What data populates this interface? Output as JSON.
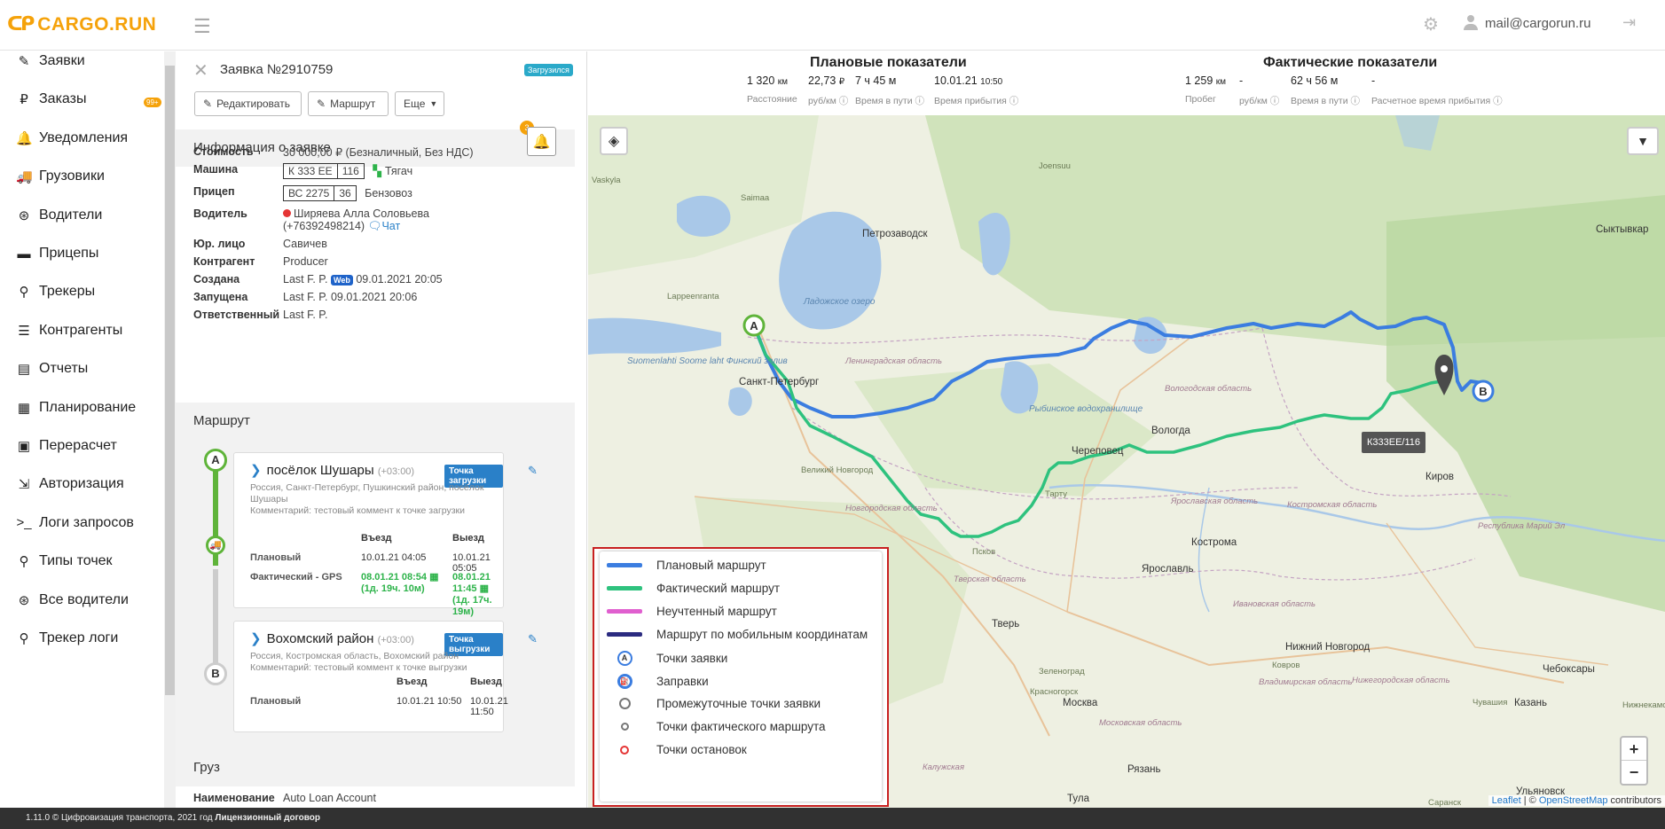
{
  "brand": {
    "name": "CARGO.RUN",
    "accent": "#f5a20a"
  },
  "topbar": {
    "user_email": "mail@cargorun.ru"
  },
  "sidebar": {
    "items": [
      {
        "label": "Заявки",
        "icon": "edit-icon"
      },
      {
        "label": "Заказы",
        "icon": "ruble-icon"
      },
      {
        "label": "Уведомления",
        "icon": "bell-icon",
        "badge": "99+"
      },
      {
        "label": "Грузовики",
        "icon": "truck-icon"
      },
      {
        "label": "Водители",
        "icon": "steering-wheel-icon"
      },
      {
        "label": "Прицепы",
        "icon": "trailer-icon"
      },
      {
        "label": "Трекеры",
        "icon": "map-pin-icon"
      },
      {
        "label": "Контрагенты",
        "icon": "list-icon"
      },
      {
        "label": "Отчеты",
        "icon": "clipboard-icon"
      },
      {
        "label": "Планирование",
        "icon": "calendar-icon"
      },
      {
        "label": "Перерасчет",
        "icon": "calculator-icon"
      },
      {
        "label": "Авторизация",
        "icon": "login-icon"
      },
      {
        "label": "Логи запросов",
        "icon": "terminal-icon"
      },
      {
        "label": "Типы точек",
        "icon": "map-pin-icon"
      },
      {
        "label": "Все водители",
        "icon": "steering-wheel-icon"
      },
      {
        "label": "Трекер логи",
        "icon": "map-pin-icon"
      }
    ]
  },
  "order": {
    "title": "Заявка №2910759",
    "status": "Загрузился",
    "buttons": {
      "edit": "Редактировать",
      "route": "Маршрут",
      "more": "Еще"
    },
    "info_heading": "Информация о заявке",
    "notifications_count": "3",
    "info": {
      "cost_label": "Стоимость",
      "cost": "30 000,00 ₽ (Безналичный, Без НДС)",
      "truck_label": "Машина",
      "truck_plate": "К 333 ЕЕ",
      "truck_region": "116",
      "truck_type": "Тягач",
      "trailer_label": "Прицеп",
      "trailer_plate": "ВС 2275",
      "trailer_region": "36",
      "trailer_type": "Бензовоз",
      "driver_label": "Водитель",
      "driver_name": "Ширяева Алла Соловьева",
      "driver_phone": "(+76392498214)",
      "chat": "Чат",
      "legal_label": "Юр. лицо",
      "legal": "Савичев",
      "contractor_label": "Контрагент",
      "contractor": "Producer",
      "created_label": "Создана",
      "created_by": "Last F. P.",
      "created_src": "Web",
      "created_at": "09.01.2021 20:05",
      "started_label": "Запущена",
      "started": "Last F. P. 09.01.2021 20:06",
      "responsible_label": "Ответственный",
      "responsible": "Last F. P."
    },
    "route_heading": "Маршрут",
    "stops": [
      {
        "letter": "A",
        "name": "посёлок Шушары",
        "tz": "(+03:00)",
        "tag": "Точка загрузки",
        "address": "Россия, Санкт-Петербург, Пушкинский район, посёлок Шушары",
        "comment": "Комментарий: тестовый коммент к точке загрузки",
        "col_in": "Въезд",
        "col_out": "Выезд",
        "plan_label": "Плановый",
        "plan_in": "10.01.21 04:05",
        "plan_out": "10.01.21 05:05",
        "fact_label": "Фактический - GPS",
        "fact_in": "08.01.21 08:54",
        "fact_in_dur": "(1д. 19ч. 10м)",
        "fact_out": "08.01.21 11:45",
        "fact_out_dur": "(1д. 17ч. 19м)"
      },
      {
        "letter": "B",
        "name": "Вохомский район",
        "tz": "(+03:00)",
        "tag": "Точка выгрузки",
        "address": "Россия, Костромская область, Вохомский район",
        "comment": "Комментарий: тестовый коммент к точке выгрузки",
        "col_in": "Въезд",
        "col_out": "Выезд",
        "plan_label": "Плановый",
        "plan_in": "10.01.21 10:50",
        "plan_out": "10.01.21 11:50"
      }
    ],
    "cargo_heading": "Груз",
    "cargo_name_label": "Наименование",
    "cargo_name": "Auto Loan Account"
  },
  "kpi": {
    "plan_title": "Плановые показатели",
    "plan": [
      {
        "value": "1 320",
        "unit": "км",
        "label": "Расстояние"
      },
      {
        "value": "22,73",
        "unit": "₽",
        "label": "руб/км"
      },
      {
        "value": "7 ч 45 м",
        "unit": "",
        "label": "Время в пути"
      },
      {
        "value": "10.01.21",
        "unit": "10:50",
        "label": "Время прибытия"
      }
    ],
    "fact_title": "Фактические показатели",
    "fact": [
      {
        "value": "1 259",
        "unit": "км",
        "label": "Пробег"
      },
      {
        "value": "-",
        "unit": "",
        "label": "руб/км"
      },
      {
        "value": "62 ч 56 м",
        "unit": "",
        "label": "Время в пути"
      },
      {
        "value": "-",
        "unit": "",
        "label": "Расчетное время прибытия"
      }
    ]
  },
  "map": {
    "truck_tooltip": "К333ЕЕ/116",
    "labels": [
      "Санкт-Петербург",
      "Великий Новгород",
      "Петрозаводск",
      "Вологда",
      "Череповец",
      "Ярославль",
      "Кострома",
      "Тверь",
      "Москва",
      "Нижний Новгород",
      "Киров",
      "Казань",
      "Чебоксары",
      "Рязань",
      "Тула",
      "Сыктывкар",
      "Тарту",
      "Lappeenranta",
      "Joensuu",
      "Ковров",
      "Зеленоград",
      "Красногорск",
      "Ульяновск",
      "Нижнекамск",
      "Псков",
      "Saimaa",
      "Ладожское озеро",
      "Вологодская область",
      "Ленинградская область",
      "Новгородская область",
      "Тверская область",
      "Ярославская область",
      "Костромская область",
      "Ивановская область",
      "Владимирская область",
      "Московская область",
      "Нижегородская область",
      "Республика Марий Эл",
      "Чувашия",
      "Suomenlahti Soome laht Финский залив",
      "Калужская",
      "Рыбинское водохранилище",
      "Саранск",
      "Vaskyla"
    ],
    "zoom_in": "+",
    "zoom_out": "−",
    "attribution_leaflet": "Leaflet",
    "attribution_sep": " | © ",
    "attribution_osm": "OpenStreetMap",
    "attribution_tail": " contributors",
    "colors": {
      "planned": "#3b7de0",
      "actual": "#2ec27e",
      "unaccounted": "#e05fcf",
      "mobile": "#2b2b80"
    }
  },
  "legend": [
    {
      "label": "Плановый маршрут",
      "type": "line",
      "color": "#3b7de0"
    },
    {
      "label": "Фактический маршрут",
      "type": "line",
      "color": "#2ec27e"
    },
    {
      "label": "Неучтенный маршрут",
      "type": "line",
      "color": "#e05fcf"
    },
    {
      "label": "Маршрут по мобильным координатам",
      "type": "line",
      "color": "#2b2b80"
    },
    {
      "label": "Точки заявки",
      "type": "point-a"
    },
    {
      "label": "Заправки",
      "type": "point-fuel"
    },
    {
      "label": "Промежуточные точки заявки",
      "type": "point-grey"
    },
    {
      "label": "Точки фактического маршрута",
      "type": "point-small"
    },
    {
      "label": "Точки остановок",
      "type": "point-red"
    }
  ],
  "footer": {
    "version": "1.11.0 © Цифровизация транспорта, 2021 год",
    "license": "Лицензионный договор"
  }
}
